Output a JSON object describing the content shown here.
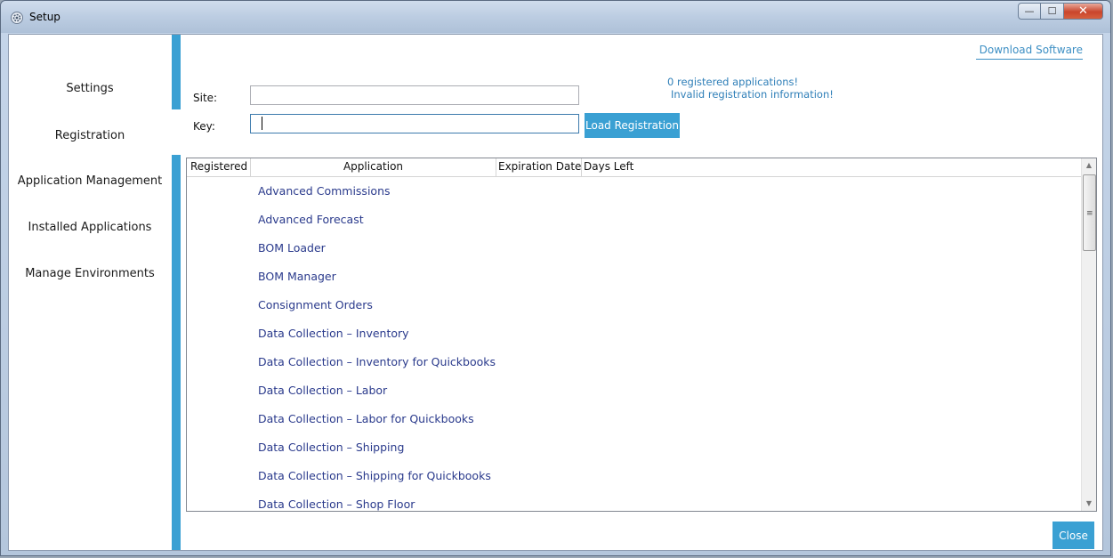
{
  "window": {
    "title": "Setup",
    "min_glyph": "—",
    "max_glyph": "☐",
    "close_glyph": "✕",
    "title_icon": "gear-icon"
  },
  "header": {
    "download_link": "Download Software"
  },
  "nav": {
    "items": [
      {
        "label": "Settings"
      },
      {
        "label": "Registration"
      },
      {
        "label": "Application Management"
      },
      {
        "label": "Installed Applications"
      },
      {
        "label": "Manage Environments"
      }
    ]
  },
  "registration": {
    "site_label": "Site:",
    "site_value": "",
    "key_label": "Key:",
    "key_value": "",
    "load_button": "Load Registration",
    "status_line1": "0 registered applications!",
    "status_line2": "Invalid registration information!"
  },
  "grid": {
    "columns": [
      "Registered",
      "Application",
      "Expiration Date",
      "Days Left"
    ],
    "rows": [
      "Advanced Commissions",
      "Advanced Forecast",
      "BOM Loader",
      "BOM Manager",
      "Consignment Orders",
      "Data Collection – Inventory",
      "Data Collection – Inventory  for Quickbooks",
      "Data Collection – Labor",
      "Data Collection – Labor for Quickbooks",
      "Data Collection – Shipping",
      "Data Collection – Shipping for Quickbooks",
      "Data Collection – Shop Floor"
    ]
  },
  "footer": {
    "close_button": "Close"
  },
  "colors": {
    "accent": "#3aa0d3",
    "link": "#2a3a8c"
  }
}
